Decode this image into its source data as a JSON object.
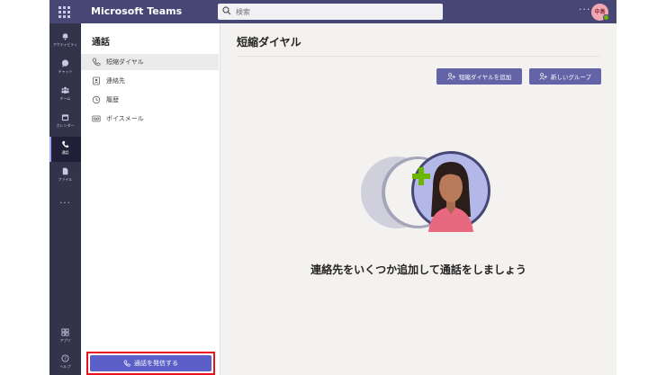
{
  "app": {
    "name": "Microsoft Teams",
    "avatar_initials": "中島"
  },
  "search": {
    "placeholder": "検索"
  },
  "rail": {
    "items": [
      {
        "label": "アクティビティ",
        "icon": "bell-icon"
      },
      {
        "label": "チャット",
        "icon": "chat-icon"
      },
      {
        "label": "チーム",
        "icon": "teams-icon"
      },
      {
        "label": "カレンダー",
        "icon": "calendar-icon"
      },
      {
        "label": "通話",
        "icon": "phone-icon"
      },
      {
        "label": "ファイル",
        "icon": "file-icon"
      },
      {
        "label": "アプリ",
        "icon": "apps-icon"
      },
      {
        "label": "ヘルプ",
        "icon": "help-icon"
      }
    ]
  },
  "pane": {
    "title": "通話",
    "items": [
      {
        "label": "短縮ダイヤル",
        "icon": "phone-icon"
      },
      {
        "label": "連絡先",
        "icon": "contacts-icon"
      },
      {
        "label": "履歴",
        "icon": "history-icon"
      },
      {
        "label": "ボイスメール",
        "icon": "voicemail-icon"
      }
    ],
    "call_button": "通話を発信する"
  },
  "main": {
    "title": "短縮ダイヤル",
    "add_speed_dial": "短縮ダイヤルを追加",
    "new_group": "新しいグループ",
    "empty_message": "連絡先をいくつか追加して通話をしましょう"
  },
  "colors": {
    "titlebar": "#464775",
    "rail": "#33344a",
    "accent": "#6264a7",
    "highlight": "#e8131e"
  }
}
